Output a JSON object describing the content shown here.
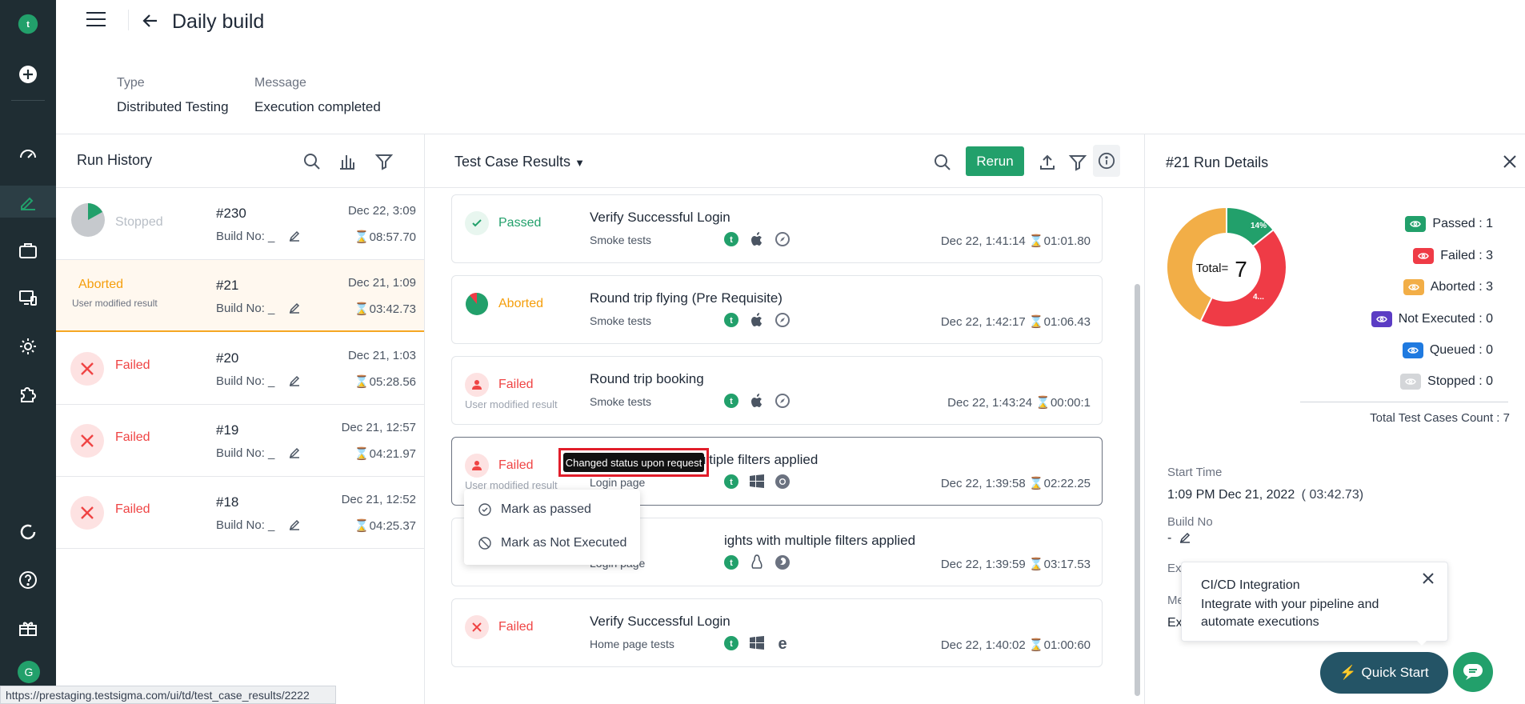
{
  "app": {
    "title": "Daily build"
  },
  "meta": [
    {
      "label": "Type",
      "value": "Distributed Testing"
    },
    {
      "label": "Message",
      "value": "Execution completed"
    }
  ],
  "sidebar": {
    "user_initial": "G"
  },
  "run_history": {
    "title": "Run History",
    "runs": [
      {
        "status": "Stopped",
        "number": "#230",
        "build": "Build No: _",
        "date": "Dec 22, 3:09",
        "duration": "08:57.70",
        "note": ""
      },
      {
        "status": "Aborted",
        "number": "#21",
        "build": "Build No: _",
        "date": "Dec 21, 1:09",
        "duration": "03:42.73",
        "note": "User modified result"
      },
      {
        "status": "Failed",
        "number": "#20",
        "build": "Build No: _",
        "date": "Dec 21, 1:03",
        "duration": "05:28.56",
        "note": ""
      },
      {
        "status": "Failed",
        "number": "#19",
        "build": "Build No: _",
        "date": "Dec 21, 12:57",
        "duration": "04:21.97",
        "note": ""
      },
      {
        "status": "Failed",
        "number": "#18",
        "build": "Build No: _",
        "date": "Dec 21, 12:52",
        "duration": "04:25.37",
        "note": ""
      }
    ]
  },
  "results": {
    "title": "Test Case Results",
    "rerun_label": "Rerun",
    "cases": [
      {
        "status": "Passed",
        "note": "",
        "name": "Verify Successful Login",
        "group": "Smoke tests",
        "datetime": "Dec 22, 1:41:14",
        "duration": "01:01.80"
      },
      {
        "status": "Aborted",
        "note": "",
        "name": "Round trip flying (Pre Requisite)",
        "group": "Smoke tests",
        "datetime": "Dec 22, 1:42:17",
        "duration": "01:06.43"
      },
      {
        "status": "Failed",
        "note": "User modified result",
        "name": "Round trip booking",
        "group": "Smoke tests",
        "datetime": "Dec 22, 1:43:24",
        "duration": "00:00:1"
      },
      {
        "status": "Failed",
        "note": "User modified result",
        "name": "ultiple filters applied",
        "group": "Login page",
        "datetime": "Dec 22, 1:39:58",
        "duration": "02:22.25"
      },
      {
        "status": "",
        "note": "",
        "name": "ights with multiple filters applied",
        "group": "Login page",
        "datetime": "Dec 22, 1:39:59",
        "duration": "03:17.53"
      },
      {
        "status": "Failed",
        "note": "",
        "name": "Verify Successful Login",
        "group": "Home page tests",
        "datetime": "Dec 22, 1:40:02",
        "duration": "01:00:60"
      }
    ],
    "tooltip": "Changed status upon request",
    "menu": [
      "Mark as passed",
      "Mark as Not Executed"
    ]
  },
  "details": {
    "title": "#21 Run Details",
    "donut_center_label": "Total=",
    "donut_center_value": "7",
    "donut_labels": [
      "14%",
      "4..."
    ],
    "donut_values": {
      "passed": 1,
      "failed": 3,
      "aborted": 3
    },
    "colors": {
      "passed": "#22a06b",
      "failed": "#ef3b46",
      "aborted": "#f2ae47",
      "not_executed": "#5b3cc4",
      "queued": "#1f7ae0",
      "stopped": "#d4d6d9"
    },
    "legend": [
      {
        "label": "Passed : 1"
      },
      {
        "label": "Failed : 3"
      },
      {
        "label": "Aborted : 3"
      },
      {
        "label": "Not Executed : 0"
      },
      {
        "label": "Queued : 0"
      },
      {
        "label": "Stopped : 0"
      }
    ],
    "total_count": "Total Test Cases Count : 7",
    "start_time_label": "Start Time",
    "start_time_value": "1:09 PM Dec 21, 2022",
    "start_duration": "(  03:42.73)",
    "build_no_label": "Build No",
    "build_no_value": "-",
    "exe_partial": "Exe",
    "me_partial": "Me",
    "ex_partial": "Ex"
  },
  "popup": {
    "title": "CI/CD Integration",
    "body": "Integrate with your pipeline and automate executions"
  },
  "quick_start": "Quick Start",
  "status_url": "https://prestaging.testsigma.com/ui/td/test_case_results/2222"
}
